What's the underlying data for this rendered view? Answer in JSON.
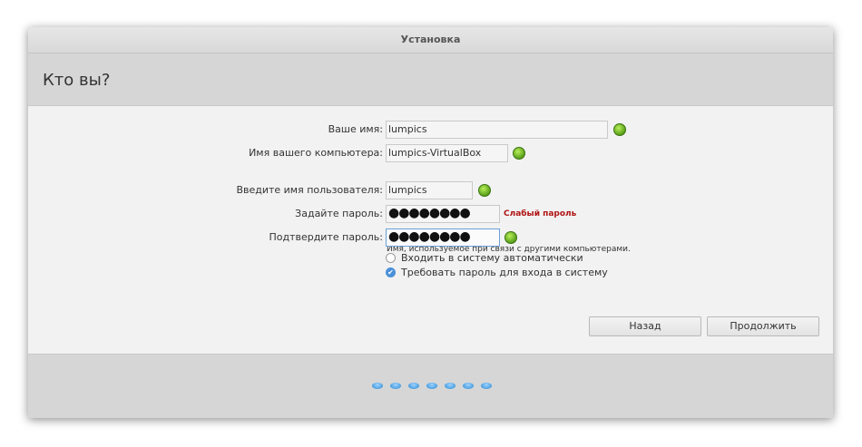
{
  "window": {
    "title": "Установка"
  },
  "header": {
    "title": "Кто вы?"
  },
  "form": {
    "name": {
      "label": "Ваше имя:",
      "value": "lumpics"
    },
    "computer": {
      "label": "Имя вашего компьютера:",
      "value": "lumpics-VirtualBox",
      "hint": "Имя, используемое при связи с другими компьютерами."
    },
    "username": {
      "label": "Введите имя пользователя:",
      "value": "lumpics"
    },
    "password": {
      "label": "Задайте пароль:",
      "value": "●●●●●●●●",
      "strength": "Слабый пароль"
    },
    "confirm": {
      "label": "Подтвердите пароль:",
      "value": "●●●●●●●●"
    },
    "login_options": [
      {
        "label": "Входить в систему автоматически",
        "selected": false
      },
      {
        "label": "Требовать пароль для входа в систему",
        "selected": true
      }
    ]
  },
  "buttons": {
    "back": "Назад",
    "continue": "Продолжить"
  },
  "progress": {
    "steps": 7
  },
  "colors": {
    "ok": "#5aa01a",
    "weak": "#b01515",
    "progress": "#4b9fe0",
    "focus": "#6aa0d8"
  }
}
